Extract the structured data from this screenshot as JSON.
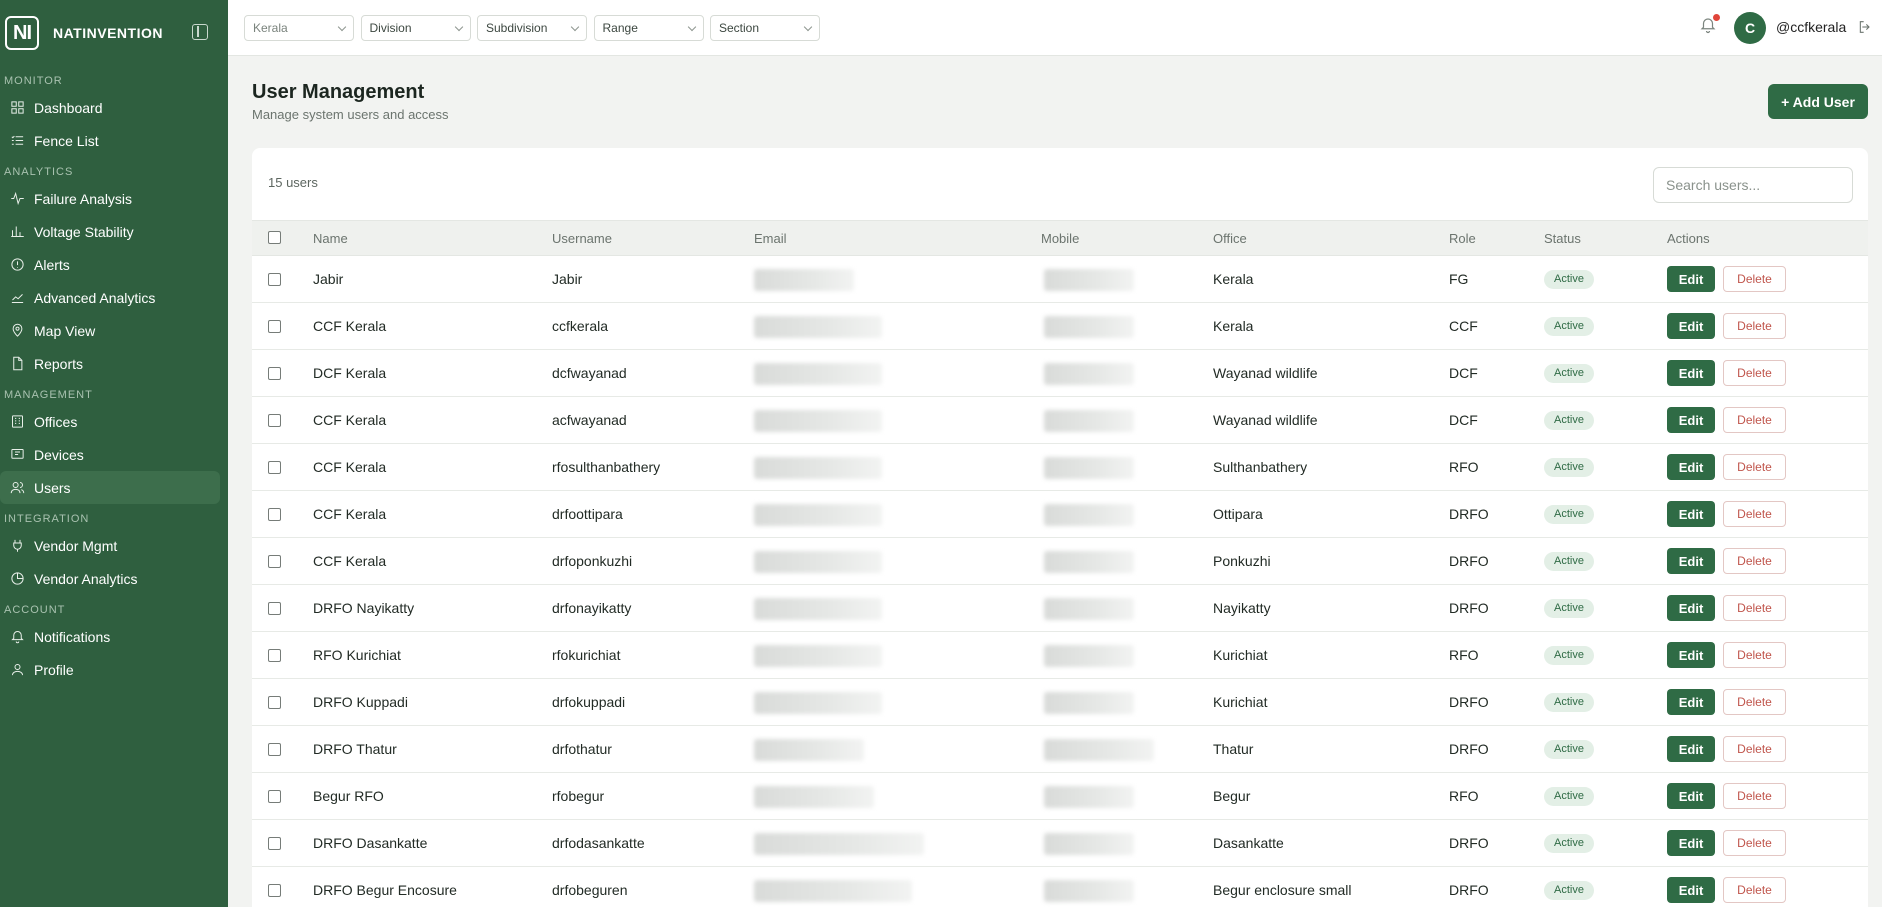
{
  "brand": {
    "logo_text": "NI",
    "name": "NATINVENTION"
  },
  "sidebar": {
    "sections": [
      {
        "label": "MONITOR",
        "items": [
          {
            "label": "Dashboard",
            "icon": "grid-icon"
          },
          {
            "label": "Fence List",
            "icon": "list-icon"
          }
        ]
      },
      {
        "label": "ANALYTICS",
        "items": [
          {
            "label": "Failure Analysis",
            "icon": "activity-icon"
          },
          {
            "label": "Voltage Stability",
            "icon": "bar-chart-icon"
          },
          {
            "label": "Alerts",
            "icon": "alert-circle-icon"
          },
          {
            "label": "Advanced Analytics",
            "icon": "trend-icon"
          },
          {
            "label": "Map View",
            "icon": "map-pin-icon"
          },
          {
            "label": "Reports",
            "icon": "file-icon"
          }
        ]
      },
      {
        "label": "MANAGEMENT",
        "items": [
          {
            "label": "Offices",
            "icon": "building-icon"
          },
          {
            "label": "Devices",
            "icon": "device-icon"
          },
          {
            "label": "Users",
            "icon": "users-icon",
            "active": true
          }
        ]
      },
      {
        "label": "INTEGRATION",
        "items": [
          {
            "label": "Vendor Mgmt",
            "icon": "plug-icon"
          },
          {
            "label": "Vendor Analytics",
            "icon": "pie-icon"
          }
        ]
      },
      {
        "label": "ACCOUNT",
        "items": [
          {
            "label": "Notifications",
            "icon": "bell-icon"
          },
          {
            "label": "Profile",
            "icon": "user-icon"
          }
        ]
      }
    ]
  },
  "filters": [
    {
      "label": "Kerala"
    },
    {
      "label": "Division"
    },
    {
      "label": "Subdivision"
    },
    {
      "label": "Range"
    },
    {
      "label": "Section"
    }
  ],
  "header": {
    "avatar_initial": "C",
    "username": "@ccfkerala"
  },
  "page": {
    "title": "User Management",
    "subtitle": "Manage system users and access",
    "add_button": "+ Add User",
    "count": "15 users",
    "search_placeholder": "Search users..."
  },
  "table": {
    "columns": [
      "Name",
      "Username",
      "Email",
      "Mobile",
      "Office",
      "Role",
      "Status",
      "Actions"
    ],
    "edit_label": "Edit",
    "delete_label": "Delete",
    "rows": [
      {
        "name": "Jabir",
        "username": "Jabir",
        "office": "Kerala",
        "role": "FG",
        "status": "Active"
      },
      {
        "name": "CCF Kerala",
        "username": "ccfkerala",
        "office": "Kerala",
        "role": "CCF",
        "status": "Active"
      },
      {
        "name": "DCF Kerala",
        "username": "dcfwayanad",
        "office": "Wayanad wildlife",
        "role": "DCF",
        "status": "Active"
      },
      {
        "name": "CCF Kerala",
        "username": "acfwayanad",
        "office": "Wayanad wildlife",
        "role": "DCF",
        "status": "Active"
      },
      {
        "name": "CCF Kerala",
        "username": "rfosulthanbathery",
        "office": "Sulthanbathery",
        "role": "RFO",
        "status": "Active"
      },
      {
        "name": "CCF Kerala",
        "username": "drfoottipara",
        "office": "Ottipara",
        "role": "DRFO",
        "status": "Active"
      },
      {
        "name": "CCF Kerala",
        "username": "drfoponkuzhi",
        "office": "Ponkuzhi",
        "role": "DRFO",
        "status": "Active"
      },
      {
        "name": "DRFO Nayikatty",
        "username": "drfonayikatty",
        "office": "Nayikatty",
        "role": "DRFO",
        "status": "Active"
      },
      {
        "name": "RFO Kurichiat",
        "username": "rfokurichiat",
        "office": "Kurichiat",
        "role": "RFO",
        "status": "Active"
      },
      {
        "name": "DRFO Kuppadi",
        "username": "drfokuppadi",
        "office": "Kurichiat",
        "role": "DRFO",
        "status": "Active"
      },
      {
        "name": "DRFO Thatur",
        "username": "drfothatur",
        "office": "Thatur",
        "role": "DRFO",
        "status": "Active"
      },
      {
        "name": "Begur RFO",
        "username": "rfobegur",
        "office": "Begur",
        "role": "RFO",
        "status": "Active"
      },
      {
        "name": "DRFO Dasankatte",
        "username": "drfodasankatte",
        "office": "Dasankatte",
        "role": "DRFO",
        "status": "Active"
      },
      {
        "name": "DRFO Begur Encosure",
        "username": "drfobeguren",
        "office": "Begur enclosure small",
        "role": "DRFO",
        "status": "Active"
      }
    ]
  }
}
